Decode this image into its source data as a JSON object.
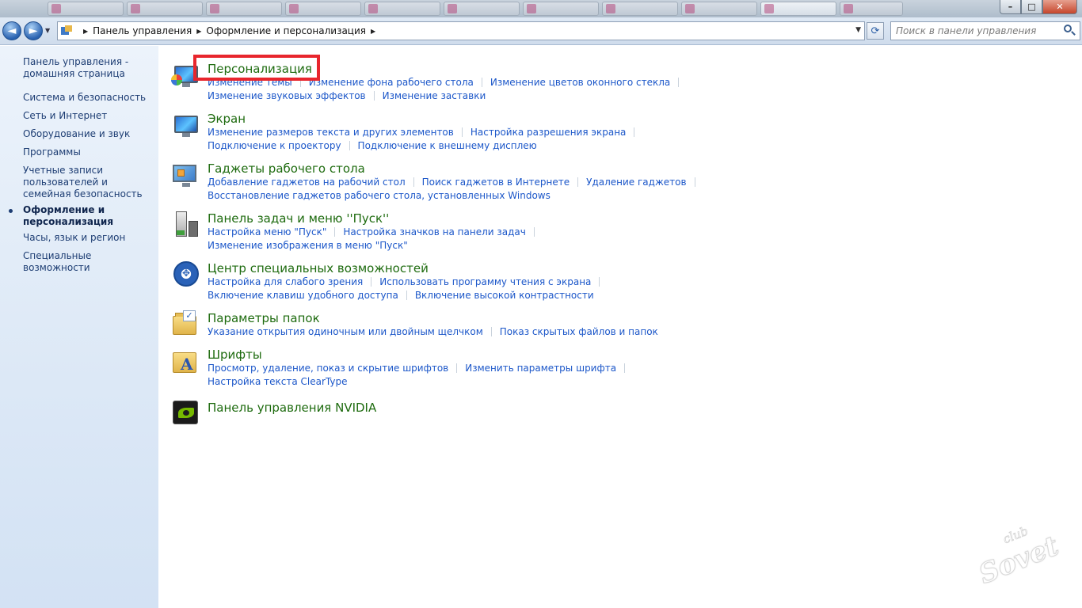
{
  "window": {
    "minimize_label": "–",
    "maximize_label": "□",
    "close_label": "✕"
  },
  "nav": {
    "back_glyph": "◄",
    "forward_glyph": "►",
    "breadcrumb": [
      "Панель управления",
      "Оформление и персонализация"
    ],
    "refresh_glyph": "⟳",
    "search_placeholder": "Поиск в панели управления"
  },
  "sidebar": {
    "items": [
      {
        "label": "Панель управления - домашняя страница"
      },
      {
        "label": "Система и безопасность"
      },
      {
        "label": "Сеть и Интернет"
      },
      {
        "label": "Оборудование и звук"
      },
      {
        "label": "Программы"
      },
      {
        "label": "Учетные записи пользователей и семейная безопасность"
      },
      {
        "label": "Оформление и персонализация",
        "current": true
      },
      {
        "label": "Часы, язык и регион"
      },
      {
        "label": "Специальные возможности"
      }
    ]
  },
  "categories": [
    {
      "icon": "personalization-icon",
      "title": "Персонализация",
      "highlighted": true,
      "rows": [
        [
          "Изменение темы",
          "Изменение фона рабочего стола",
          "Изменение цветов оконного стекла"
        ],
        [
          "Изменение звуковых эффектов",
          "Изменение заставки"
        ]
      ]
    },
    {
      "icon": "display-icon",
      "title": "Экран",
      "rows": [
        [
          "Изменение размеров текста и других элементов",
          "Настройка разрешения экрана"
        ],
        [
          "Подключение к проектору",
          "Подключение к внешнему дисплею"
        ]
      ]
    },
    {
      "icon": "gadgets-icon",
      "title": "Гаджеты рабочего стола",
      "rows": [
        [
          "Добавление гаджетов на рабочий стол",
          "Поиск гаджетов в Интернете",
          "Удаление гаджетов"
        ],
        [
          "Восстановление гаджетов рабочего стола, установленных Windows"
        ]
      ]
    },
    {
      "icon": "taskbar-icon",
      "title": "Панель задач и меню ''Пуск''",
      "rows": [
        [
          "Настройка меню \"Пуск\"",
          "Настройка значков на панели задач"
        ],
        [
          "Изменение изображения в меню \"Пуск\""
        ]
      ]
    },
    {
      "icon": "ease-of-access-icon",
      "title": "Центр специальных возможностей",
      "rows": [
        [
          "Настройка для слабого зрения",
          "Использовать программу чтения с экрана"
        ],
        [
          "Включение клавиш удобного доступа",
          "Включение высокой контрастности"
        ]
      ]
    },
    {
      "icon": "folder-options-icon",
      "title": "Параметры папок",
      "rows": [
        [
          "Указание открытия одиночным или двойным щелчком",
          "Показ скрытых файлов и папок"
        ]
      ]
    },
    {
      "icon": "fonts-icon",
      "title": "Шрифты",
      "rows": [
        [
          "Просмотр, удаление, показ и скрытие шрифтов",
          "Изменить параметры шрифта"
        ],
        [
          "Настройка текста ClearType"
        ]
      ]
    },
    {
      "icon": "nvidia-icon",
      "title": "Панель управления NVIDIA",
      "rows": []
    }
  ],
  "watermark": {
    "line1": "Sovet",
    "line2": "club"
  },
  "colors": {
    "highlight_box": "#e8262d",
    "category_title": "#1e6b0f",
    "task_link": "#1c57c9",
    "sidebar_link": "#1d3d73"
  }
}
